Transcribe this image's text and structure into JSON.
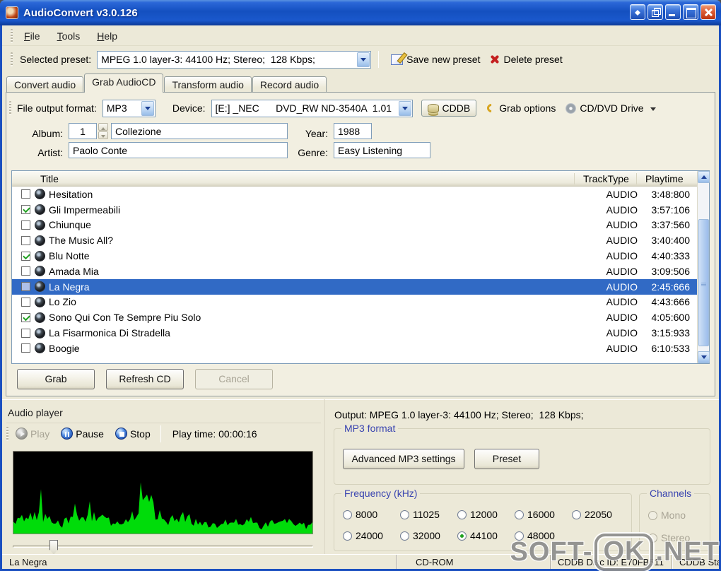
{
  "window": {
    "title": "AudioConvert v3.0.126"
  },
  "menu": {
    "items": [
      "File",
      "Tools",
      "Help"
    ]
  },
  "toolbar": {
    "preset_label": "Selected preset:",
    "preset_value": "MPEG 1.0 layer-3: 44100 Hz; Stereo;  128 Kbps;",
    "save_label": "Save new preset",
    "delete_label": "Delete preset"
  },
  "tabs": [
    {
      "label": "Convert audio",
      "active": false
    },
    {
      "label": "Grab AudioCD",
      "active": true
    },
    {
      "label": "Transform audio",
      "active": false
    },
    {
      "label": "Record audio",
      "active": false
    }
  ],
  "grab_tab": {
    "file_output_label": "File output format:",
    "file_output_value": "MP3",
    "device_label": "Device:",
    "device_value": "[E:] _NEC      DVD_RW ND-3540A  1.01",
    "cddb_label": "CDDB",
    "grab_options_label": "Grab options",
    "cddvd_label": "CD/DVD Drive",
    "album_label": "Album:",
    "album_number": "1",
    "album_title": "Collezione",
    "year_label": "Year:",
    "year_value": "1988",
    "artist_label": "Artist:",
    "artist_value": "Paolo Conte",
    "genre_label": "Genre:",
    "genre_value": "Easy Listening",
    "table": {
      "columns": [
        "Title",
        "TrackType",
        "Playtime"
      ],
      "rows": [
        {
          "title": "Hesitation",
          "checked": false,
          "selected": false,
          "type": "AUDIO",
          "playtime": "3:48:800"
        },
        {
          "title": "Gli Impermeabili",
          "checked": true,
          "selected": false,
          "type": "AUDIO",
          "playtime": "3:57:106"
        },
        {
          "title": "Chiunque",
          "checked": false,
          "selected": false,
          "type": "AUDIO",
          "playtime": "3:37:560"
        },
        {
          "title": "The Music All?",
          "checked": false,
          "selected": false,
          "type": "AUDIO",
          "playtime": "3:40:400"
        },
        {
          "title": "Blu Notte",
          "checked": true,
          "selected": false,
          "type": "AUDIO",
          "playtime": "4:40:333"
        },
        {
          "title": "Amada Mia",
          "checked": false,
          "selected": false,
          "type": "AUDIO",
          "playtime": "3:09:506"
        },
        {
          "title": "La Negra",
          "checked": false,
          "selected": true,
          "type": "AUDIO",
          "playtime": "2:45:666"
        },
        {
          "title": "Lo Zio",
          "checked": false,
          "selected": false,
          "type": "AUDIO",
          "playtime": "4:43:666"
        },
        {
          "title": "Sono Qui Con Te Sempre Piu Solo",
          "checked": true,
          "selected": false,
          "type": "AUDIO",
          "playtime": "4:05:600"
        },
        {
          "title": "La Fisarmonica Di Stradella",
          "checked": false,
          "selected": false,
          "type": "AUDIO",
          "playtime": "3:15:933"
        },
        {
          "title": "Boogie",
          "checked": false,
          "selected": false,
          "type": "AUDIO",
          "playtime": "6:10:533"
        }
      ]
    },
    "buttons": {
      "grab": "Grab",
      "refresh": "Refresh CD",
      "cancel": "Cancel"
    }
  },
  "audio_player": {
    "title": "Audio player",
    "play": "Play",
    "pause": "Pause",
    "stop": "Stop",
    "playtime": "Play time: 00:00:16"
  },
  "output_panel": {
    "output_text": "Output: MPEG 1.0 layer-3: 44100 Hz; Stereo;  128 Kbps;",
    "mp3_group": "MP3 format",
    "advanced_btn": "Advanced MP3 settings",
    "preset_btn": "Preset",
    "freq_group": "Frequency (kHz)",
    "frequencies": [
      {
        "label": "8000",
        "selected": false
      },
      {
        "label": "11025",
        "selected": false
      },
      {
        "label": "12000",
        "selected": false
      },
      {
        "label": "16000",
        "selected": false
      },
      {
        "label": "22050",
        "selected": false
      },
      {
        "label": "24000",
        "selected": false
      },
      {
        "label": "32000",
        "selected": false
      },
      {
        "label": "44100",
        "selected": true
      },
      {
        "label": "48000",
        "selected": false
      }
    ],
    "channels_group": "Channels",
    "channels": [
      {
        "label": "Mono",
        "disabled": true
      },
      {
        "label": "Stereo",
        "disabled": true
      }
    ]
  },
  "statusbar": {
    "track": "La Negra",
    "drive": "CD-ROM",
    "disc_id": "CDDB Disc ID: E70FB511",
    "status": "CDDB Status: Idle"
  },
  "watermark": {
    "prefix": "SOFT-",
    "ok": "OK",
    "suffix": ".NET"
  },
  "colors": {
    "frame-blue": "#1a4fc0",
    "selection": "#316ac5",
    "check-green": "#21a121",
    "group-blue": "#3a45b0",
    "wave-green": "#00dc0a"
  }
}
